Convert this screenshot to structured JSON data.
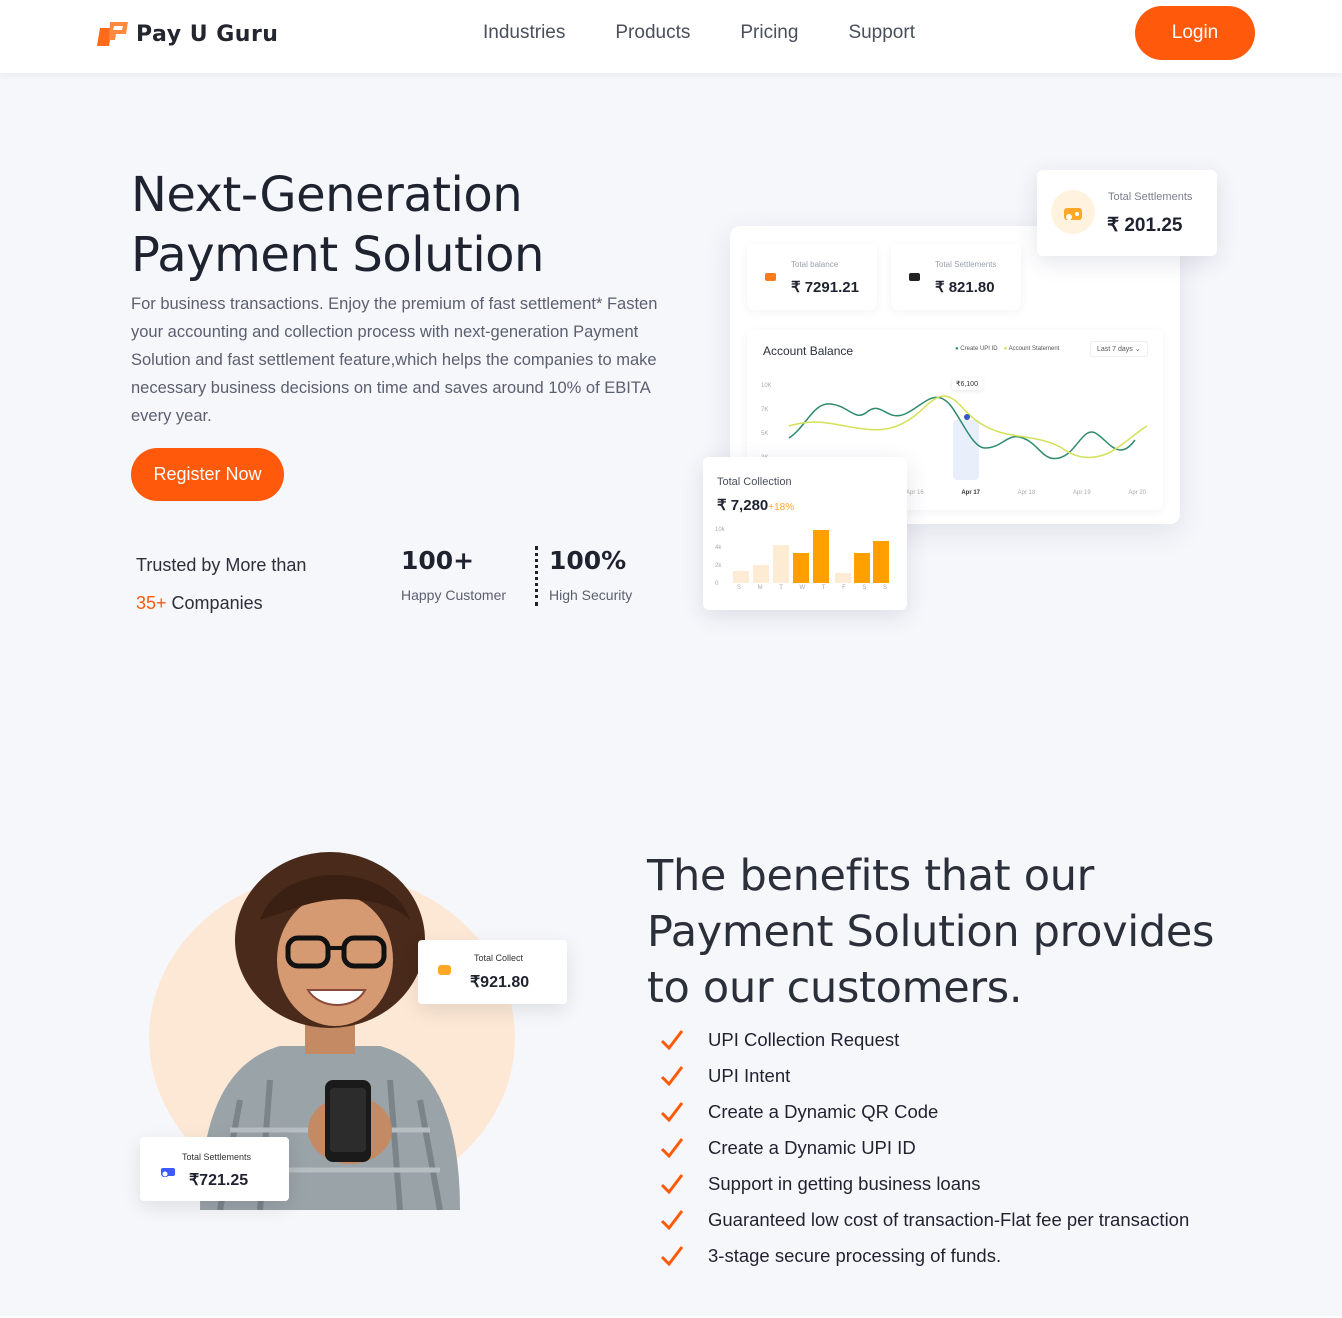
{
  "brand": {
    "name": "Pay U Guru",
    "accent": "#ff5a0b"
  },
  "nav": {
    "links": [
      "Industries",
      "Products",
      "Pricing",
      "Support"
    ],
    "login": "Login"
  },
  "hero": {
    "title_line1": "Next-Generation",
    "title_line2": "Payment Solution",
    "description": "For business transactions. Enjoy the premium of fast settlement* Fasten your accounting and collection process with next-generation Payment Solution and fast settlement feature,which helps the companies to make necessary business decisions on time and saves around 10% of EBITA every year.",
    "register": "Register Now",
    "trusted_line1": "Trusted by More than",
    "trusted_count": "35+",
    "trusted_suffix": " Companies",
    "stats": [
      {
        "num": "100+",
        "label": "Happy Customer"
      },
      {
        "num": "100%",
        "label": "High Security"
      }
    ]
  },
  "dashboard": {
    "total_balance_label": "Total balance",
    "total_balance": "₹ 7291.21",
    "total_settlements_label": "Total Settlements",
    "total_settlements": "₹ 821.80",
    "float_settlements_label": "Total Settlements",
    "float_settlements": "₹ 201.25",
    "chart_title": "Account Balance",
    "legend": [
      "Create UPI ID",
      "Account Statement"
    ],
    "range": "Last 7 days",
    "y_ticks": [
      "10K",
      "7K",
      "5K",
      "3K"
    ],
    "x_ticks": [
      "Apr 16",
      "Apr 17",
      "Apr 18",
      "Apr 19",
      "Apr 20"
    ],
    "tooltip": "₹6,100",
    "collection_label": "Total Collection",
    "collection_value": "₹ 7,280",
    "collection_change": "+18%",
    "bar_y_ticks": [
      "10k",
      "4k",
      "2k",
      "0"
    ],
    "bar_days": [
      "S",
      "M",
      "T",
      "W",
      "T",
      "F",
      "S",
      "S"
    ]
  },
  "benefits": {
    "title_line1": "The benefits that our",
    "title_line2": "Payment Solution provides",
    "title_line3": "to our customers.",
    "items": [
      "UPI Collection Request",
      "UPI Intent",
      "Create a Dynamic QR Code",
      "Create a Dynamic UPI ID",
      "Support in getting business loans",
      "Guaranteed low cost of transaction-Flat fee per transaction",
      "3-stage secure processing of funds."
    ],
    "collect_label": "Total Collect",
    "collect_value": "₹921.80",
    "settle_label": "Total Settlements",
    "settle_value": "₹721.25"
  }
}
